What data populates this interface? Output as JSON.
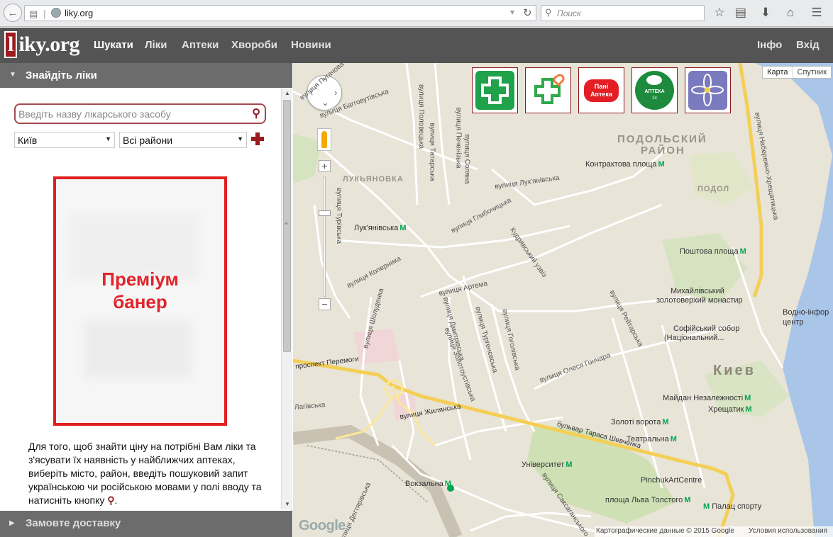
{
  "browser": {
    "url": "liky.org",
    "search_placeholder": "Поиск",
    "icons": [
      "back-icon",
      "tabs-icon",
      "globe-icon",
      "dropdown-icon",
      "reload-icon",
      "search-icon",
      "star-icon",
      "reader-icon",
      "download-icon",
      "home-icon",
      "menu-icon"
    ]
  },
  "header": {
    "logo_first": "l",
    "logo_rest": "iky.org",
    "nav": [
      "Шукати",
      "Ліки",
      "Аптеки",
      "Хвороби",
      "Новини"
    ],
    "nav_right": [
      "Інфо",
      "Вхід"
    ],
    "active_nav": "Шукати"
  },
  "sidebar": {
    "find_title": "Знайдіть ліки",
    "search_placeholder": "Введіть назву лікарського засобу",
    "city": "Київ",
    "district": "Всі райони",
    "banner_line1": "Преміум",
    "banner_line2": "банер",
    "help_text": "Для того, щоб знайти ціну на потрібні Вам ліки та з'ясувати їх наявність у найближчих аптеках, виберіть місто, район, введіть пошуковий запит українською чи російською мовами у полі вводу та натисніть кнопку",
    "help_end": ".",
    "delivery_title": "Замовте доставку"
  },
  "map": {
    "type_map": "Карта",
    "type_sat": "Спутник",
    "chains": [
      {
        "name": "pharmacy-chain-1",
        "label": "",
        "color": "#1fa24a"
      },
      {
        "name": "pharmacy-chain-2",
        "label": "",
        "color": "#2fa94a"
      },
      {
        "name": "pharmacy-chain-3",
        "label": "Пані Аптека",
        "color": "#e31e24"
      },
      {
        "name": "pharmacy-chain-4",
        "label": "АПТЕКА",
        "sub": "24",
        "color": "#1d8a3d"
      },
      {
        "name": "pharmacy-chain-5",
        "label": "",
        "color": "#7a7abf"
      }
    ],
    "districts": [
      "ЛУКЬЯНОВКА",
      "ПОДОЛЬСКИЙ",
      "РАЙОН",
      "ПОДОЛ",
      "Киев"
    ],
    "streets": [
      "вулиця Пугачова",
      "вулиця Багговутівська",
      "вулиця Половецька",
      "вулиця Татарська",
      "вулиця Печенізька",
      "вулиця Соляна",
      "вулиця Турівська",
      "вулиця Лук'янівська",
      "вулиця Глибочицька",
      "Кудрявський узвіз",
      "вулиця Коперника",
      "вулиця Артема",
      "вулиця Шолуденка",
      "вулиця Дмитрівська",
      "вулиця Тургенєвська",
      "вулиця Гоголівська",
      "вулиця Рейтарська",
      "вулиця Олеся Гончара",
      "вулиця Золотоустівська",
      "проспект Перемоги",
      "вулиця Жилянська",
      "бульвар Тараса Шевченка",
      "вулиця Саксаганського",
      "вулиця Дегтярівська",
      "вулиця Набережно-Хрещатицька",
      "Лагівська"
    ],
    "places": [
      {
        "name": "Контрактова площа",
        "metro": true
      },
      {
        "name": "Лук'янівська",
        "metro": true
      },
      {
        "name": "Поштова площа",
        "metro": true
      },
      {
        "name": "Михайлівський",
        "metro": false
      },
      {
        "name": "золотоверхий монастир",
        "metro": false
      },
      {
        "name": "Водно-інфор",
        "metro": false
      },
      {
        "name": "центр",
        "metro": false
      },
      {
        "name": "Софійський собор",
        "metro": false
      },
      {
        "name": "(Національний...",
        "metro": false
      },
      {
        "name": "Майдан Незалежності",
        "metro": true
      },
      {
        "name": "Хрещатик",
        "metro": true
      },
      {
        "name": "Золоті ворота",
        "metro": true
      },
      {
        "name": "Театральна",
        "metro": true
      },
      {
        "name": "Університет",
        "metro": true
      },
      {
        "name": "PinchukArtCentre",
        "metro": false
      },
      {
        "name": "Вокзальна",
        "metro": true
      },
      {
        "name": "площа Льва Толстого",
        "metro": true
      },
      {
        "name": "Палац спорту",
        "metro": true
      }
    ],
    "metro_glyph": "M",
    "footer_data": "Картографические данные © 2015 Google",
    "footer_terms": "Условия использования",
    "google": "Google"
  }
}
